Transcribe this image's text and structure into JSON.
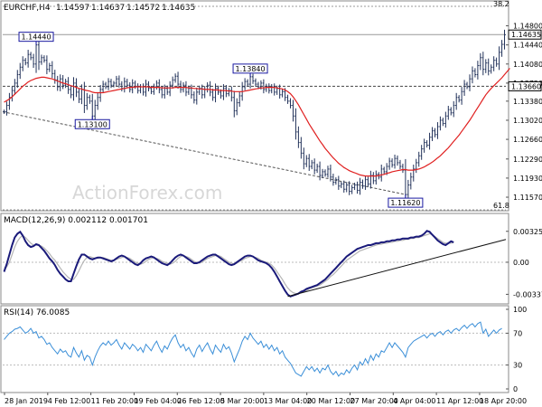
{
  "chart_data": {
    "type": "line",
    "title": "EURCHF,H4",
    "ohlc": {
      "open": "1.14597",
      "high": "1.14637",
      "low": "1.14572",
      "close": "1.14635"
    },
    "watermark": "ActionForex.com",
    "x_labels": [
      "28 Jan 2019",
      "4 Feb 12:00",
      "11 Feb 20:00",
      "19 Feb 04:00",
      "26 Feb 12:00",
      "5 Mar 20:00",
      "13 Mar 04:00",
      "20 Mar 12:00",
      "27 Mar 20:00",
      "4 Apr 04:00",
      "11 Apr 12:00",
      "18 Apr 20:00"
    ],
    "price_panel": {
      "ylim": [
        1.114,
        1.1515
      ],
      "y_ticks": [
        "1.14800",
        "1.14440",
        "1.14080",
        "1.13720",
        "1.13380",
        "1.13020",
        "1.12660",
        "1.12290",
        "1.11930",
        "1.11570"
      ],
      "current_price": "1.14635",
      "horizontal_level": "1.13660",
      "fib_top_label": "38.2",
      "fib_bottom_label": "61.8",
      "annotations": [
        {
          "text": "1.14440",
          "index": 12,
          "value": 1.1444,
          "position": "above"
        },
        {
          "text": "1.13100",
          "index": 33,
          "value": 1.131,
          "position": "below"
        },
        {
          "text": "1.13840",
          "index": 92,
          "value": 1.1384,
          "position": "above"
        },
        {
          "text": "1.11620",
          "index": 150,
          "value": 1.1162,
          "position": "below"
        }
      ],
      "close": [
        1.1318,
        1.133,
        1.1345,
        1.1358,
        1.1372,
        1.1388,
        1.1402,
        1.1415,
        1.141,
        1.1426,
        1.142,
        1.1408,
        1.1444,
        1.1412,
        1.142,
        1.1415,
        1.1398,
        1.1405,
        1.139,
        1.1378,
        1.1365,
        1.138,
        1.1368,
        1.1375,
        1.136,
        1.135,
        1.1372,
        1.1355,
        1.1342,
        1.136,
        1.133,
        1.1345,
        1.1338,
        1.131,
        1.133,
        1.1345,
        1.136,
        1.137,
        1.1365,
        1.1375,
        1.1368,
        1.1372,
        1.138,
        1.137,
        1.1362,
        1.1375,
        1.1368,
        1.136,
        1.1372,
        1.1366,
        1.1358,
        1.1365,
        1.1355,
        1.137,
        1.1362,
        1.1356,
        1.1365,
        1.1372,
        1.136,
        1.135,
        1.1362,
        1.1355,
        1.1368,
        1.1378,
        1.1385,
        1.137,
        1.136,
        1.1368,
        1.1355,
        1.1362,
        1.135,
        1.134,
        1.1355,
        1.1362,
        1.135,
        1.136,
        1.1368,
        1.1355,
        1.1345,
        1.1362,
        1.1355,
        1.1348,
        1.1362,
        1.1352,
        1.1358,
        1.1345,
        1.132,
        1.1335,
        1.1348,
        1.1365,
        1.1375,
        1.137,
        1.1384,
        1.1376,
        1.137,
        1.1365,
        1.1372,
        1.136,
        1.1366,
        1.1358,
        1.1365,
        1.1355,
        1.1362,
        1.135,
        1.1356,
        1.1345,
        1.1338,
        1.133,
        1.131,
        1.128,
        1.126,
        1.124,
        1.122,
        1.123,
        1.1215,
        1.1222,
        1.1208,
        1.1215,
        1.1198,
        1.1205,
        1.12,
        1.121,
        1.1195,
        1.1185,
        1.119,
        1.1178,
        1.1182,
        1.1172,
        1.118,
        1.1168,
        1.1175,
        1.118,
        1.117,
        1.1185,
        1.1178,
        1.119,
        1.1182,
        1.1198,
        1.1188,
        1.12,
        1.1195,
        1.121,
        1.1205,
        1.1215,
        1.1225,
        1.1218,
        1.123,
        1.1222,
        1.1215,
        1.1208,
        1.1162,
        1.118,
        1.1195,
        1.121,
        1.1222,
        1.1235,
        1.1248,
        1.126,
        1.1255,
        1.127,
        1.1282,
        1.1275,
        1.129,
        1.1302,
        1.1296,
        1.131,
        1.1322,
        1.1316,
        1.133,
        1.1345,
        1.134,
        1.1356,
        1.137,
        1.1365,
        1.138,
        1.1395,
        1.1388,
        1.1405,
        1.142,
        1.1398,
        1.141,
        1.1395,
        1.1402,
        1.1415,
        1.1408,
        1.143,
        1.1445,
        1.1463
      ],
      "ma": [
        1.1336,
        1.1339,
        1.1342,
        1.1346,
        1.1351,
        1.1356,
        1.1361,
        1.1366,
        1.137,
        1.1374,
        1.1377,
        1.1379,
        1.1381,
        1.1382,
        1.1383,
        1.1383,
        1.1382,
        1.1381,
        1.138,
        1.1378,
        1.1376,
        1.1374,
        1.1372,
        1.1371,
        1.1369,
        1.1367,
        1.1366,
        1.1364,
        1.1362,
        1.1361,
        1.1359,
        1.1358,
        1.1357,
        1.1355,
        1.1354,
        1.1354,
        1.1354,
        1.1354,
        1.1355,
        1.1356,
        1.1357,
        1.1358,
        1.1359,
        1.136,
        1.1361,
        1.1362,
        1.1363,
        1.1364,
        1.1364,
        1.1365,
        1.1365,
        1.1365,
        1.1365,
        1.1365,
        1.1365,
        1.1364,
        1.1364,
        1.1364,
        1.1364,
        1.1363,
        1.1363,
        1.1363,
        1.1363,
        1.1363,
        1.1364,
        1.1364,
        1.1364,
        1.1364,
        1.1364,
        1.1363,
        1.1363,
        1.1362,
        1.1362,
        1.1361,
        1.1361,
        1.136,
        1.136,
        1.136,
        1.1359,
        1.1359,
        1.1359,
        1.1358,
        1.1358,
        1.1358,
        1.1357,
        1.1357,
        1.1356,
        1.1356,
        1.1356,
        1.1356,
        1.1357,
        1.1358,
        1.1359,
        1.136,
        1.1361,
        1.1362,
        1.1363,
        1.1363,
        1.1364,
        1.1364,
        1.1364,
        1.1364,
        1.1363,
        1.1362,
        1.1361,
        1.1359,
        1.1356,
        1.1352,
        1.1346,
        1.1339,
        1.1331,
        1.1322,
        1.1313,
        1.1304,
        1.1295,
        1.1287,
        1.1279,
        1.1271,
        1.1263,
        1.1256,
        1.1249,
        1.1243,
        1.1237,
        1.1231,
        1.1226,
        1.1221,
        1.1217,
        1.1213,
        1.121,
        1.1207,
        1.1205,
        1.1203,
        1.1201,
        1.1199,
        1.1198,
        1.1197,
        1.1197,
        1.1197,
        1.1197,
        1.1197,
        1.1198,
        1.1199,
        1.12,
        1.1202,
        1.1203,
        1.1205,
        1.1206,
        1.1207,
        1.1208,
        1.1209,
        1.1209,
        1.1208,
        1.1208,
        1.1208,
        1.1209,
        1.121,
        1.1212,
        1.1214,
        1.1217,
        1.122,
        1.1223,
        1.1227,
        1.1231,
        1.1235,
        1.124,
        1.1245,
        1.125,
        1.1256,
        1.1262,
        1.1268,
        1.1274,
        1.1281,
        1.1288,
        1.1295,
        1.1302,
        1.131,
        1.1318,
        1.1326,
        1.1334,
        1.1342,
        1.135,
        1.1356,
        1.1362,
        1.1367,
        1.1372,
        1.1377,
        1.1382,
        1.1388,
        1.1394,
        1.14
      ]
    },
    "macd_panel": {
      "label": "MACD(12,26,9) 0.002112 0.001701",
      "ylim": [
        -0.004,
        0.0038
      ],
      "y_ticks": [
        "0.003253",
        "0.00",
        "-0.003373"
      ],
      "macd": [
        -0.001,
        -0.0002,
        0.0008,
        0.0018,
        0.0026,
        0.003,
        0.0032,
        0.0028,
        0.0022,
        0.0018,
        0.0016,
        0.0017,
        0.0019,
        0.0018,
        0.0015,
        0.0012,
        0.0008,
        0.0004,
        0.0001,
        -0.0003,
        -0.0008,
        -0.0012,
        -0.0015,
        -0.0018,
        -0.002,
        -0.002,
        -0.0012,
        -0.0004,
        0.0003,
        0.0008,
        0.0008,
        0.0006,
        0.0004,
        0.0003,
        0.0004,
        0.0005,
        0.0005,
        0.0004,
        0.0003,
        0.0002,
        0.0001,
        0.0002,
        0.0004,
        0.0006,
        0.0007,
        0.0006,
        0.0004,
        0.0002,
        0.0,
        -0.0002,
        -0.0003,
        -0.0001,
        0.0002,
        0.0004,
        0.0005,
        0.0006,
        0.0005,
        0.0003,
        0.0001,
        -0.0001,
        -0.0002,
        -0.0003,
        -0.0001,
        0.0002,
        0.0005,
        0.0007,
        0.0008,
        0.0007,
        0.0005,
        0.0003,
        0.0001,
        -0.0001,
        -0.0001,
        0.0,
        0.0002,
        0.0004,
        0.0006,
        0.0007,
        0.0008,
        0.0008,
        0.0006,
        0.0004,
        0.0002,
        0.0,
        -0.0002,
        -0.0003,
        -0.0002,
        0.0,
        0.0002,
        0.0004,
        0.0006,
        0.0007,
        0.0007,
        0.0006,
        0.0004,
        0.0002,
        0.0001,
        0.0,
        -0.0001,
        -0.0003,
        -0.0006,
        -0.001,
        -0.0015,
        -0.002,
        -0.0025,
        -0.003,
        -0.0034,
        -0.0036,
        -0.0035,
        -0.0034,
        -0.0033,
        -0.0031,
        -0.003,
        -0.0028,
        -0.0027,
        -0.0026,
        -0.0025,
        -0.0024,
        -0.0022,
        -0.002,
        -0.0018,
        -0.0015,
        -0.0012,
        -0.0009,
        -0.0006,
        -0.0003,
        0.0,
        0.0003,
        0.0006,
        0.0008,
        0.001,
        0.0012,
        0.0014,
        0.0015,
        0.0016,
        0.0017,
        0.0018,
        0.0018,
        0.0019,
        0.002,
        0.002,
        0.0021,
        0.0021,
        0.0022,
        0.0022,
        0.0023,
        0.0023,
        0.0024,
        0.0024,
        0.0025,
        0.0025,
        0.0025,
        0.0026,
        0.0026,
        0.0027,
        0.0027,
        0.0028,
        0.003,
        0.0033,
        0.0032,
        0.0029,
        0.0026,
        0.0023,
        0.0021,
        0.0019,
        0.0018,
        0.002,
        0.0022,
        0.0021
      ],
      "signal": [
        -0.0006,
        -0.0005,
        0.0,
        0.0008,
        0.0016,
        0.0022,
        0.0026,
        0.0028,
        0.0026,
        0.0023,
        0.002,
        0.0018,
        0.0018,
        0.0018,
        0.0017,
        0.0015,
        0.0012,
        0.0009,
        0.0005,
        0.0002,
        -0.0002,
        -0.0006,
        -0.001,
        -0.0013,
        -0.0016,
        -0.0018,
        -0.0018,
        -0.0014,
        -0.0009,
        -0.0003,
        0.0002,
        0.0005,
        0.0006,
        0.0005,
        0.0004,
        0.0004,
        0.0005,
        0.0005,
        0.0004,
        0.0003,
        0.0002,
        0.0002,
        0.0003,
        0.0004,
        0.0005,
        0.0006,
        0.0005,
        0.0004,
        0.0002,
        0.0,
        -0.0001,
        -0.0002,
        -0.0001,
        0.0001,
        0.0003,
        0.0004,
        0.0005,
        0.0004,
        0.0003,
        0.0001,
        0.0,
        -0.0001,
        -0.0002,
        -0.0001,
        0.0001,
        0.0004,
        0.0006,
        0.0007,
        0.0006,
        0.0005,
        0.0003,
        0.0001,
        0.0,
        -0.0001,
        0.0,
        0.0002,
        0.0004,
        0.0005,
        0.0006,
        0.0007,
        0.0007,
        0.0006,
        0.0004,
        0.0002,
        0.0,
        -0.0001,
        -0.0002,
        -0.0001,
        0.0001,
        0.0002,
        0.0004,
        0.0005,
        0.0006,
        0.0006,
        0.0005,
        0.0004,
        0.0002,
        0.0001,
        0.0,
        -0.0001,
        -0.0003,
        -0.0006,
        -0.001,
        -0.0014,
        -0.0018,
        -0.0023,
        -0.0027,
        -0.003,
        -0.0032,
        -0.0033,
        -0.0033,
        -0.0032,
        -0.0031,
        -0.003,
        -0.0028,
        -0.0027,
        -0.0026,
        -0.0025,
        -0.0024,
        -0.0022,
        -0.002,
        -0.0018,
        -0.0015,
        -0.0013,
        -0.001,
        -0.0007,
        -0.0004,
        -0.0001,
        0.0002,
        0.0004,
        0.0006,
        0.0008,
        0.001,
        0.0012,
        0.0013,
        0.0014,
        0.0015,
        0.0016,
        0.0017,
        0.0018,
        0.0019,
        0.0019,
        0.002,
        0.002,
        0.0021,
        0.0021,
        0.0022,
        0.0022,
        0.0023,
        0.0023,
        0.0024,
        0.0024,
        0.0025,
        0.0025,
        0.0026,
        0.0026,
        0.0027,
        0.0028,
        0.0029,
        0.003,
        0.0029,
        0.0027,
        0.0025,
        0.0023,
        0.0021,
        0.002,
        0.002,
        0.002,
        0.0021
      ]
    },
    "rsi_panel": {
      "label": "RSI(14) 76.0085",
      "ylim": [
        0,
        100
      ],
      "y_ticks": [
        "100",
        "70",
        "30",
        "0"
      ],
      "rsi": [
        62,
        66,
        70,
        72,
        75,
        76,
        78,
        74,
        70,
        72,
        76,
        70,
        72,
        64,
        66,
        62,
        56,
        58,
        52,
        48,
        44,
        50,
        46,
        48,
        42,
        40,
        52,
        45,
        40,
        48,
        36,
        42,
        40,
        30,
        40,
        48,
        54,
        58,
        55,
        60,
        55,
        58,
        62,
        55,
        50,
        58,
        54,
        50,
        56,
        53,
        48,
        52,
        46,
        56,
        52,
        48,
        55,
        60,
        52,
        46,
        54,
        50,
        58,
        64,
        68,
        58,
        52,
        56,
        48,
        52,
        45,
        40,
        50,
        55,
        47,
        53,
        58,
        50,
        44,
        55,
        50,
        46,
        56,
        50,
        53,
        45,
        34,
        42,
        50,
        60,
        66,
        62,
        70,
        64,
        60,
        56,
        60,
        52,
        56,
        50,
        55,
        48,
        52,
        44,
        48,
        40,
        36,
        32,
        26,
        20,
        18,
        16,
        22,
        28,
        24,
        28,
        22,
        26,
        20,
        26,
        24,
        30,
        22,
        18,
        22,
        16,
        20,
        18,
        24,
        20,
        26,
        30,
        24,
        34,
        30,
        38,
        32,
        42,
        36,
        44,
        40,
        48,
        46,
        52,
        58,
        52,
        58,
        54,
        50,
        46,
        40,
        52,
        56,
        60,
        62,
        64,
        66,
        68,
        64,
        68,
        70,
        66,
        70,
        72,
        68,
        72,
        74,
        70,
        74,
        76,
        73,
        77,
        80,
        76,
        80,
        82,
        78,
        82,
        84,
        70,
        75,
        66,
        70,
        74,
        70,
        74,
        76
      ]
    }
  }
}
